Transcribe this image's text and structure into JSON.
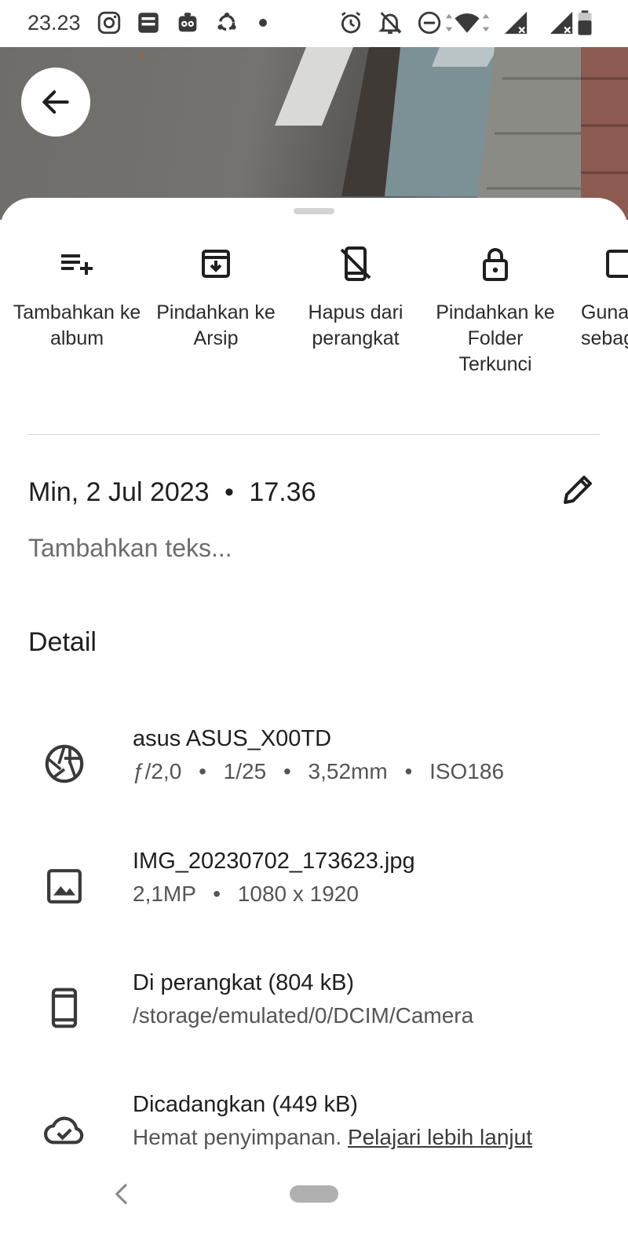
{
  "status_bar": {
    "time": "23.23",
    "left_icons": [
      "instagram-icon",
      "brimo-app-icon",
      "tripadvisor-icon",
      "share-it-icon",
      "notification-dot-icon"
    ],
    "right_icons": [
      "alarm-icon",
      "notifications-off-icon",
      "do-not-disturb-icon",
      "wifi-icon",
      "signal-sim1-icon",
      "signal-sim2-icon",
      "battery-icon"
    ]
  },
  "actions": [
    {
      "label": "Tambahkan ke album",
      "icon": "playlist-add-icon"
    },
    {
      "label": "Pindahkan ke Arsip",
      "icon": "archive-icon"
    },
    {
      "label": "Hapus dari perangkat",
      "icon": "phone-off-icon"
    },
    {
      "label": "Pindahkan ke Folder Terkunci",
      "icon": "lock-icon"
    },
    {
      "label": "Gunakan sebagai",
      "icon": "wallpaper-icon"
    }
  ],
  "info": {
    "date": "Min, 2 Jul 2023",
    "time": "17.36",
    "caption_placeholder": "Tambahkan teks..."
  },
  "details": {
    "title": "Detail",
    "camera": {
      "model": "asus ASUS_X00TD",
      "aperture": "ƒ/2,0",
      "shutter": "1/25",
      "focal": "3,52mm",
      "iso": "ISO186"
    },
    "file": {
      "name": "IMG_20230702_173623.jpg",
      "megapixels": "2,1MP",
      "resolution": "1080 x 1920"
    },
    "device": {
      "title": "Di perangkat (804 kB)",
      "path": "/storage/emulated/0/DCIM/Camera"
    },
    "backup": {
      "title": "Dicadangkan (449 kB)",
      "text": "Hemat penyimpanan.",
      "link": "Pelajari lebih lanjut"
    }
  },
  "separator": "•"
}
